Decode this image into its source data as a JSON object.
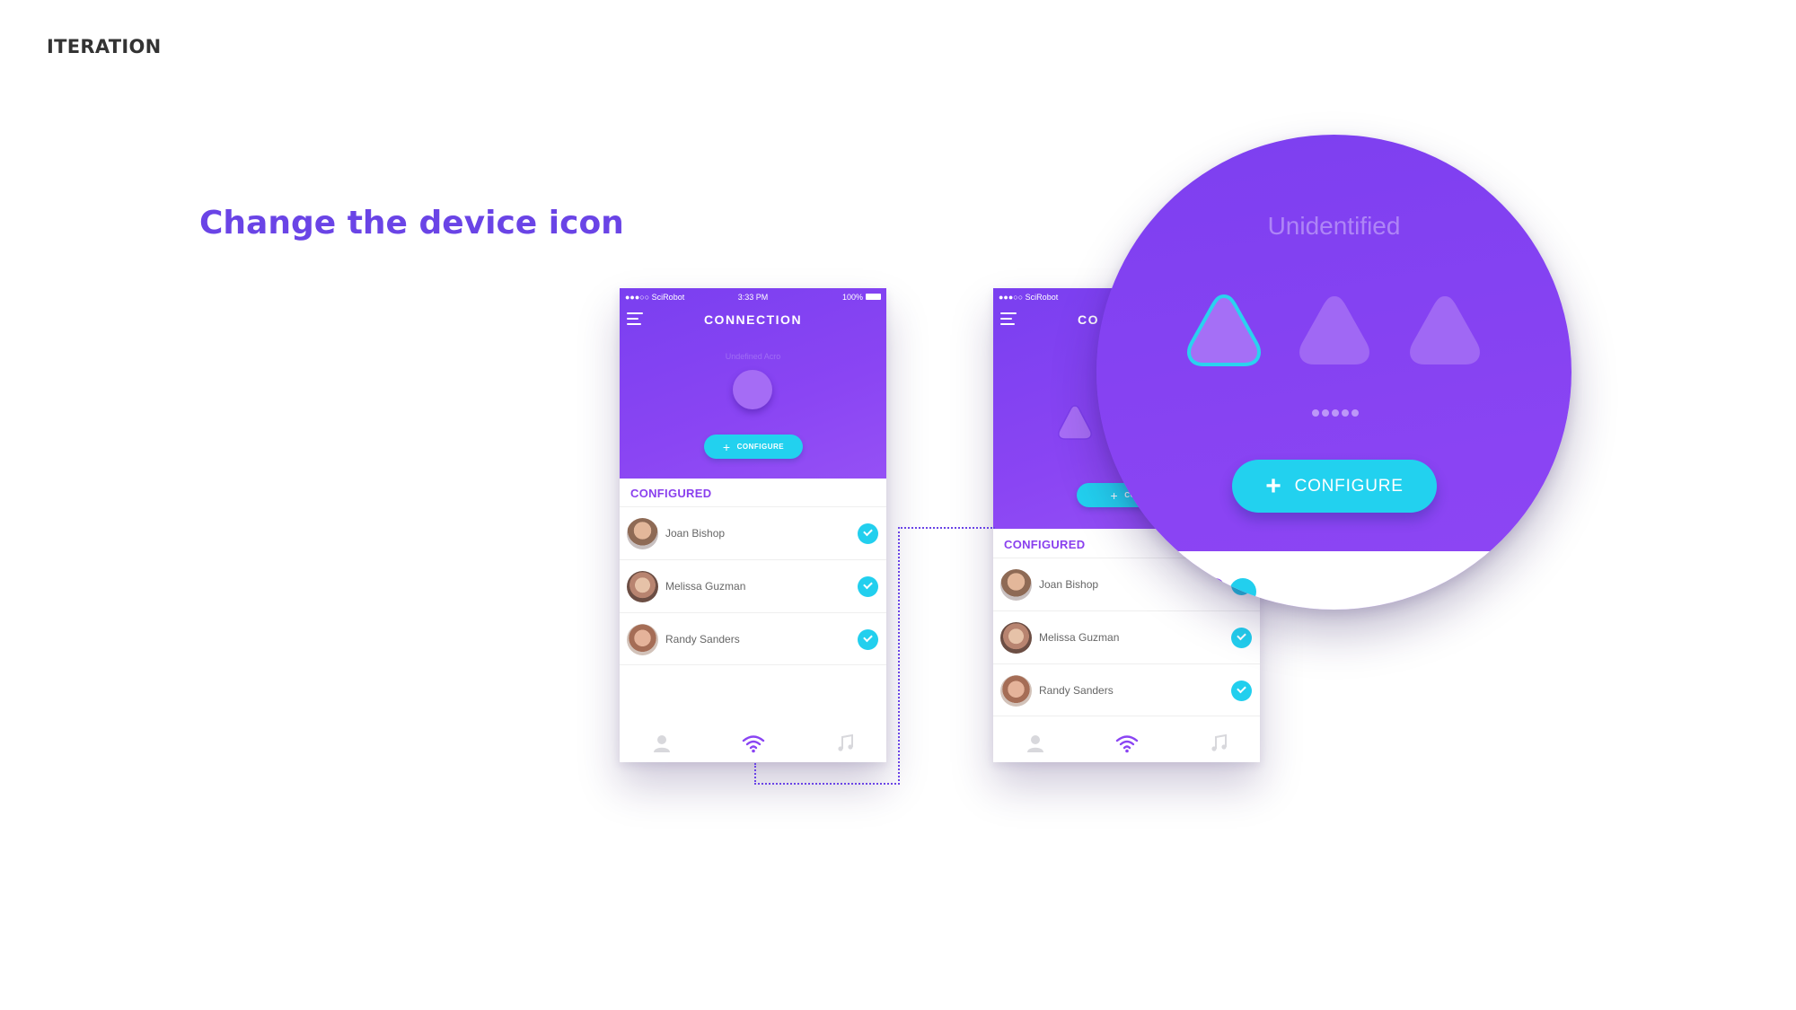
{
  "page": {
    "section_label": "ITERATION",
    "headline": "Change the device icon"
  },
  "colors": {
    "accent_purple": "#8a44f3",
    "headline_blue": "#6a44e6",
    "configure_cyan": "#22d1ef"
  },
  "phone_a": {
    "status": {
      "carrier": "●●●○○ SciRobot",
      "time": "3:33 PM",
      "battery": "100%"
    },
    "title": "CONNECTION",
    "device_name": "Undefined Acro",
    "configure_label": "CONFIGURE",
    "configured_label": "CONFIGURED",
    "contacts": [
      {
        "name": "Joan Bishop"
      },
      {
        "name": "Melissa Guzman"
      },
      {
        "name": "Randy Sanders"
      }
    ],
    "tabs": [
      "user-icon",
      "wifi-icon",
      "music-icon"
    ],
    "active_tab": 1
  },
  "phone_b": {
    "status": {
      "carrier": "●●●○○ SciRobot"
    },
    "title_partial": "CO",
    "configure_partial": "CON",
    "configured_label": "CONFIGURED",
    "contacts": [
      {
        "name": "Joan Bishop"
      },
      {
        "name": "Melissa Guzman"
      },
      {
        "name": "Randy Sanders"
      }
    ],
    "tabs": [
      "user-icon",
      "wifi-icon",
      "music-icon"
    ],
    "active_tab": 1
  },
  "magnifier": {
    "title": "Unidentified",
    "icons": [
      "device-triangle-icon",
      "device-triangle-icon",
      "device-triangle-icon"
    ],
    "selected_icon": 0,
    "page_dots": 5,
    "configure_label": "CONFIGURE",
    "peek_text": "ED"
  }
}
